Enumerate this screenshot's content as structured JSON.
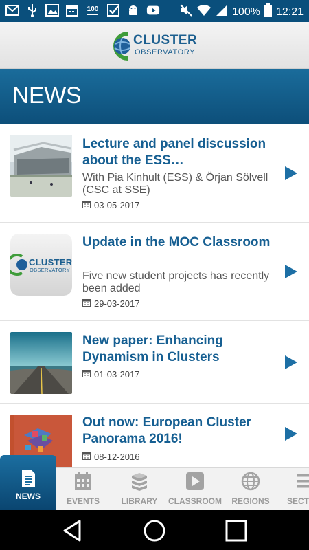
{
  "status_bar": {
    "left_icons": [
      "gmail-icon",
      "usb-icon",
      "image-icon",
      "calendar-icon",
      "badge-100-icon",
      "check-icon",
      "android-icon",
      "youtube-icon"
    ],
    "badge_text": "100",
    "battery": "100%",
    "time": "12:21"
  },
  "header": {
    "logo_line1": "CLUSTER",
    "logo_line2": "OBSERVATORY"
  },
  "page_title": "NEWS",
  "news": [
    {
      "title": "Lecture and panel discussion about the ESS…",
      "subtitle": "With Pia Kinhult (ESS) & Örjan Sölvell (CSC at SSE)",
      "date": "03-05-2017",
      "thumb": "building-photo"
    },
    {
      "title": "Update in the MOC Classroom",
      "subtitle": "Five new student projects has recently been added",
      "date": "29-03-2017",
      "thumb": "cluster-observatory-logo",
      "thumb_line1": "CLUSTER",
      "thumb_line2": "OBSERVATORY"
    },
    {
      "title": "New paper: Enhancing Dynamism in Clusters",
      "subtitle": "",
      "date": "01-03-2017",
      "thumb": "road-photo"
    },
    {
      "title": "Out now: European Cluster Panorama 2016!",
      "subtitle": "",
      "date": "08-12-2016",
      "thumb": "report-cover"
    }
  ],
  "tabs": [
    {
      "label": "NEWS",
      "icon": "document-icon",
      "active": true
    },
    {
      "label": "EVENTS",
      "icon": "calendar-icon",
      "active": false
    },
    {
      "label": "LIBRARY",
      "icon": "books-icon",
      "active": false
    },
    {
      "label": "CLASSROOM",
      "icon": "play-icon",
      "active": false
    },
    {
      "label": "REGIONS",
      "icon": "globe-icon",
      "active": false
    },
    {
      "label": "SECT",
      "icon": "menu-icon",
      "active": false
    }
  ],
  "colors": {
    "primary": "#0d4f7a",
    "title_text": "#165f92",
    "arrow": "#1d6fa5"
  }
}
